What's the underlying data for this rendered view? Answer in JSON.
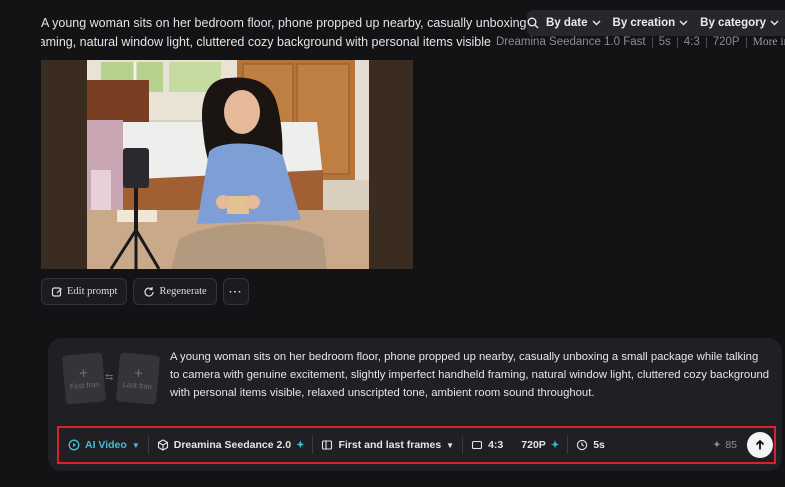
{
  "result": {
    "prompt_line1": "A young woman sits on her bedroom floor, phone propped up nearby, casually unboxing a small package",
    "prompt_line2": "slightly imperfect handheld framing, natural window light, cluttered cozy background with personal items visible",
    "model": "Dreamina Seedance 1.0 Fast",
    "duration": "5s",
    "ratio": "4:3",
    "resolution": "720P",
    "more_info": "More info"
  },
  "filters": {
    "by_date": "By date",
    "by_creation": "By creation",
    "by_category": "By category"
  },
  "actions": {
    "edit_prompt": "Edit prompt",
    "regenerate": "Regenerate",
    "more": "···"
  },
  "composer": {
    "first_frame": "First fran",
    "last_frame": "Last fran",
    "prompt": "A young woman sits on her bedroom floor, phone propped up nearby, casually unboxing a small package while talking to camera with genuine excitement, slightly imperfect handheld framing, natural window light, cluttered cozy background with personal items visible, relaxed unscripted tone, ambient room sound throughout."
  },
  "toolbar": {
    "mode": "AI Video",
    "model": "Dreamina Seedance 2.0",
    "frames": "First and last frames",
    "ratio": "4:3",
    "resolution": "720P",
    "duration": "5s",
    "credits": "85"
  },
  "colors": {
    "accent": "#3fc0d2",
    "highlight_border": "#d8202f",
    "background": "#131316"
  }
}
